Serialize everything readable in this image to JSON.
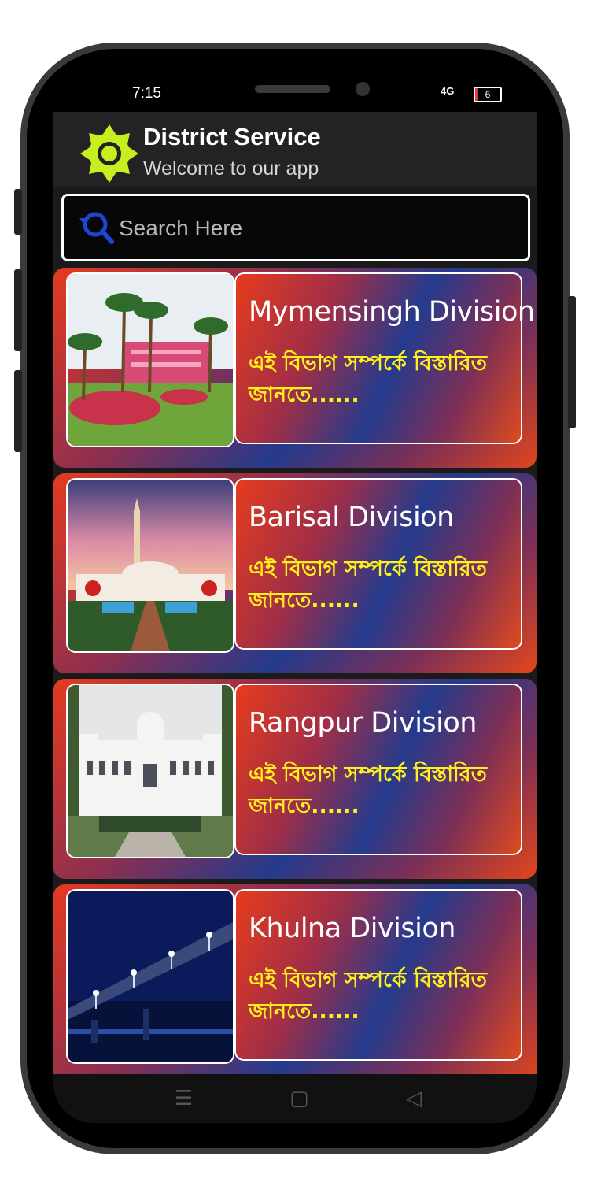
{
  "status_bar": {
    "time": "7:15",
    "network": "4G",
    "battery": "6"
  },
  "app_bar": {
    "title": "District Service",
    "subtitle": "Welcome to our app",
    "logo_icon": "gear-sun-icon",
    "logo_color": "#c6ef1f"
  },
  "search": {
    "placeholder": "Search Here",
    "value": "",
    "icon": "search-icon",
    "icon_color": "#1c47d6"
  },
  "divisions": [
    {
      "title": "Mymensingh Division",
      "description": "এই বিভাগ সম্পর্কে বিস্তারিত জানতে......",
      "image_icon": "palm-garden-building-image"
    },
    {
      "title": "Barisal Division",
      "description": "এই বিভাগ সম্পর্কে বিস্তারিত জানতে......",
      "image_icon": "mosque-minaret-sunset-image"
    },
    {
      "title": "Rangpur Division",
      "description": "এই বিভাগ সম্পর্কে বিস্তারিত জানতে......",
      "image_icon": "white-palace-image"
    },
    {
      "title": "Khulna Division",
      "description": "এই বিভাগ সম্পর্কে বিস্তারিত জানতে......",
      "image_icon": "night-bridge-image"
    }
  ],
  "nav_bar": {
    "menu": "☰",
    "home": "▢",
    "back": "◁"
  },
  "colors": {
    "accent_text": "#ffef1a",
    "card_red": "#e43b20",
    "card_blue": "#243a8c"
  }
}
